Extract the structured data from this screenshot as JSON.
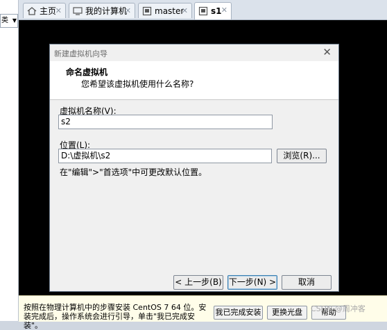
{
  "left_panel": {
    "combo_text": "类"
  },
  "tabs": [
    {
      "label": "主页",
      "icon": "home-icon"
    },
    {
      "label": "我的计算机",
      "icon": "computer-icon"
    },
    {
      "label": "master",
      "icon": "vm-icon"
    },
    {
      "label": "s1",
      "icon": "vm-icon",
      "active": true
    }
  ],
  "dialog": {
    "title": "新建虚拟机向导",
    "heading": "命名虚拟机",
    "subheading": "您希望该虚拟机使用什么名称?",
    "name_label": "虚拟机名称(V):",
    "name_value": "s2",
    "location_label": "位置(L):",
    "location_value": "D:\\虚拟机\\s2",
    "browse_label": "浏览(R)...",
    "hint": "在\"编辑\">\"首选项\"中可更改默认位置。",
    "back_label": "< 上一步(B)",
    "next_label": "下一步(N) >",
    "cancel_label": "取消"
  },
  "bottom_bar": {
    "message": "按照在物理计算机中的步骤安装 CentOS 7 64 位。安装完成后，操作系统会进行引导，单击\"我已完成安装\"。",
    "done_label": "我已完成安装",
    "change_disc_label": "更换光盘",
    "help_label": "帮助",
    "watermark": "CSDN @周冲客"
  },
  "colors": {
    "accent": "#3c7fb1",
    "vm_background": "#000000",
    "hint_bar": "#fffde9"
  }
}
